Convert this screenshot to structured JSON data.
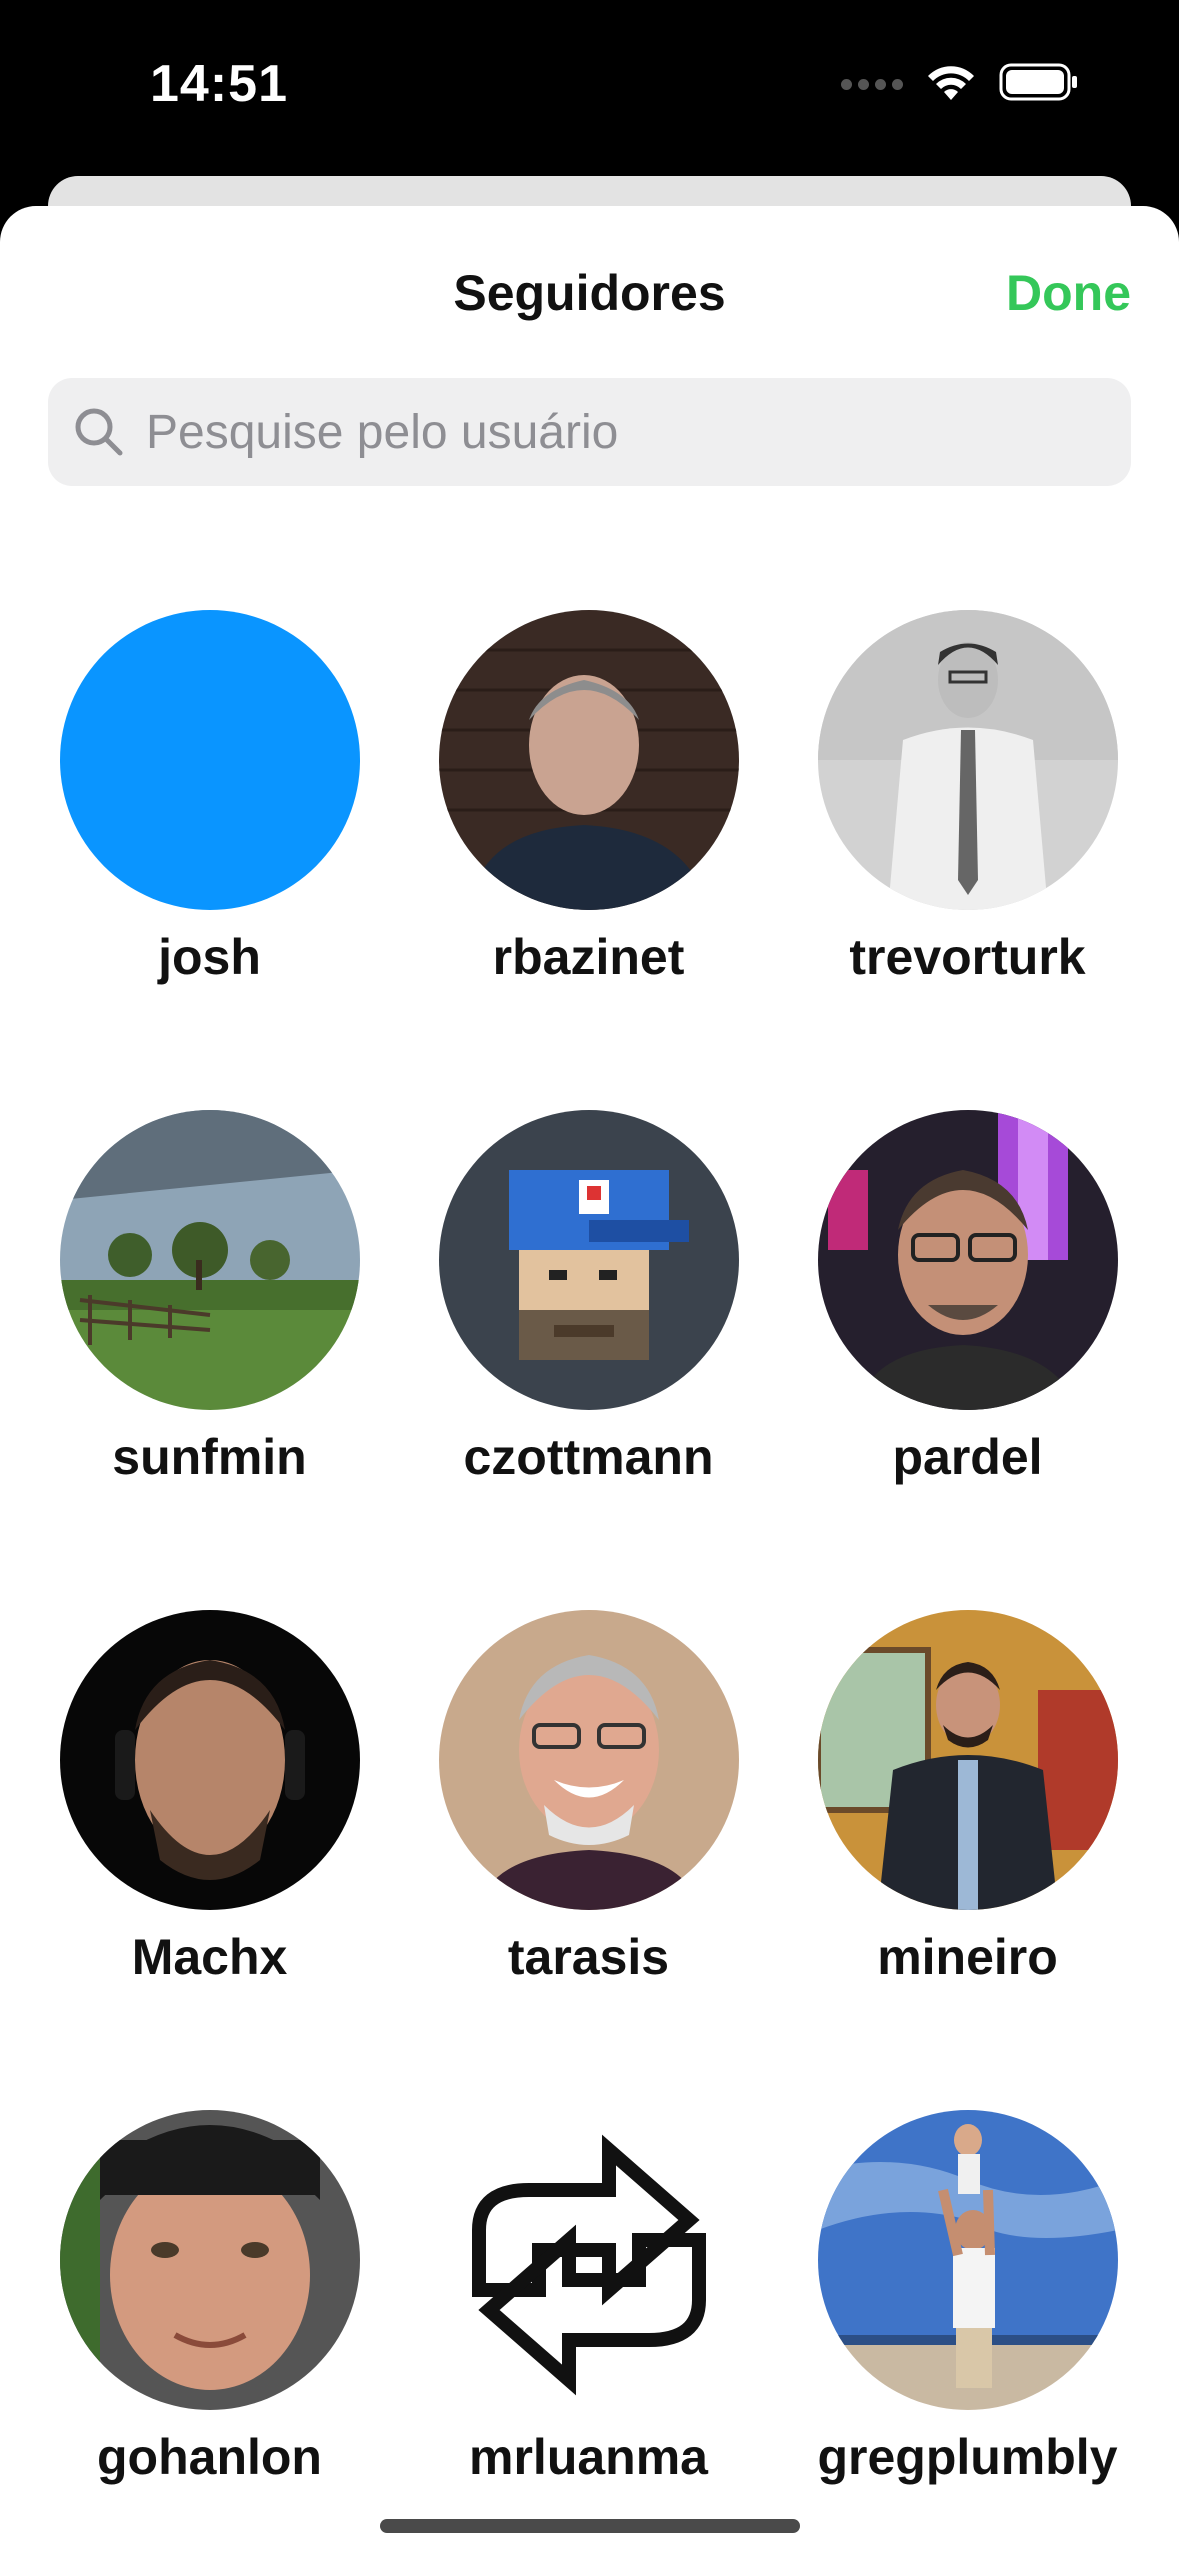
{
  "status_bar": {
    "time": "14:51",
    "icons": [
      "signal-dots-icon",
      "wifi-icon",
      "battery-icon"
    ]
  },
  "sheet": {
    "title": "Seguidores",
    "done_label": "Done",
    "done_color": "#34c759"
  },
  "search": {
    "placeholder": "Pesquise pelo usuário",
    "value": ""
  },
  "users": [
    {
      "username": "josh",
      "avatar": "solid-blue-avatar",
      "color": "#0a95ff"
    },
    {
      "username": "rbazinet",
      "avatar": "man-brick-wall-photo"
    },
    {
      "username": "trevorturk",
      "avatar": "man-tie-bw-photo"
    },
    {
      "username": "sunfmin",
      "avatar": "field-landscape-photo"
    },
    {
      "username": "czottmann",
      "avatar": "pixel-art-cap-avatar"
    },
    {
      "username": "pardel",
      "avatar": "man-glasses-neon-photo"
    },
    {
      "username": "Machx",
      "avatar": "man-headphones-photo"
    },
    {
      "username": "tarasis",
      "avatar": "man-smiling-glasses-photo"
    },
    {
      "username": "mineiro",
      "avatar": "man-train-photo"
    },
    {
      "username": "gohanlon",
      "avatar": "man-beanie-photo"
    },
    {
      "username": "mrluanma",
      "avatar": "pixel-arrows-logo"
    },
    {
      "username": "gregplumbly",
      "avatar": "beach-child-photo"
    }
  ]
}
